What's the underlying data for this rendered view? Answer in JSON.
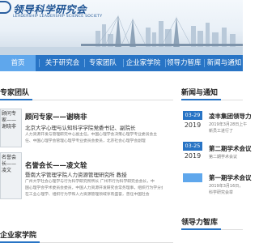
{
  "site": {
    "title": "领导科学研究会",
    "subtitle": "LEADERSHIP LEADERSHIP SCIENCE SOCIETY"
  },
  "nav": {
    "items": [
      {
        "label": "首页",
        "active": true
      },
      {
        "label": "关于研究会",
        "active": false
      },
      {
        "label": "专家团队",
        "active": false
      },
      {
        "label": "企业家学院",
        "active": false
      },
      {
        "label": "领导力智库",
        "active": false
      },
      {
        "label": "新闻与通知",
        "active": false
      }
    ]
  },
  "experts": {
    "heading": "专家团队",
    "items": [
      {
        "photo_caption": "顾问专家——谢晓非",
        "name": "顾问专家——谢晓非",
        "title": "北京大学心理与认知科学学院党委书记、副院长",
        "desc": [
          "人力资源开发与管理研究中心副主任。中国心理学会决策心理学专业委员会主",
          "任、中国心理学会管理心理学专业委员会委员，北京社会心理学会副理"
        ]
      },
      {
        "photo_caption": "名誉会长——凌文",
        "name": "名誉会长——凌文辁",
        "title": "暨南大学管理学院人力资源管理研究所 教授",
        "desc": [
          "广州大学社会心理学与行为科学研究所所长 广州市行为科学研究会会长，中",
          "国心理学会学术委员会委员，中国人力资源开发研究会常务理事，组织行为学分会",
          "在工业心理学、组织行为学和人力资源管理领域享有盛誉，曾任中国社会"
        ]
      }
    ]
  },
  "news": {
    "heading": "新闻与通知",
    "items": [
      {
        "day": "03-29",
        "year": "2019",
        "title": "凌丰集团领导力",
        "desc": [
          "2019年3月28日上午",
          "新员工进行了"
        ]
      },
      {
        "day": "03-25",
        "year": "2019",
        "title": "第二期学术会议",
        "desc": [
          "第二期学术会议"
        ]
      },
      {
        "day": "",
        "year": "",
        "title": "第一期学术会议",
        "desc": [
          "2019年3月16日，",
          "科学研究会举"
        ]
      }
    ]
  },
  "college": {
    "heading": "企业家学院"
  },
  "thinktank": {
    "heading": "领导力智库"
  },
  "colors": {
    "brand": "#2874c5",
    "nav_active": "#5fa7ec"
  }
}
